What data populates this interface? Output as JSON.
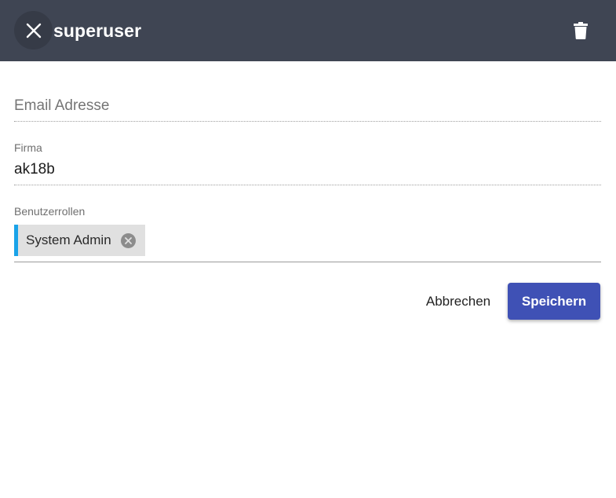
{
  "header": {
    "title": "superuser",
    "close_icon": "close-icon",
    "delete_icon": "trash-icon",
    "background": "#3f4553"
  },
  "form": {
    "email": {
      "placeholder": "Email Adresse",
      "value": ""
    },
    "company": {
      "label": "Firma",
      "value": "ak18b"
    },
    "roles": {
      "label": "Benutzerrollen",
      "chips": [
        {
          "label": "System Admin",
          "remove_icon": "remove-circle-icon",
          "accent": "#1aa3e8"
        }
      ]
    }
  },
  "actions": {
    "cancel_label": "Abbrechen",
    "save_label": "Speichern",
    "save_color": "#3f51b5"
  }
}
